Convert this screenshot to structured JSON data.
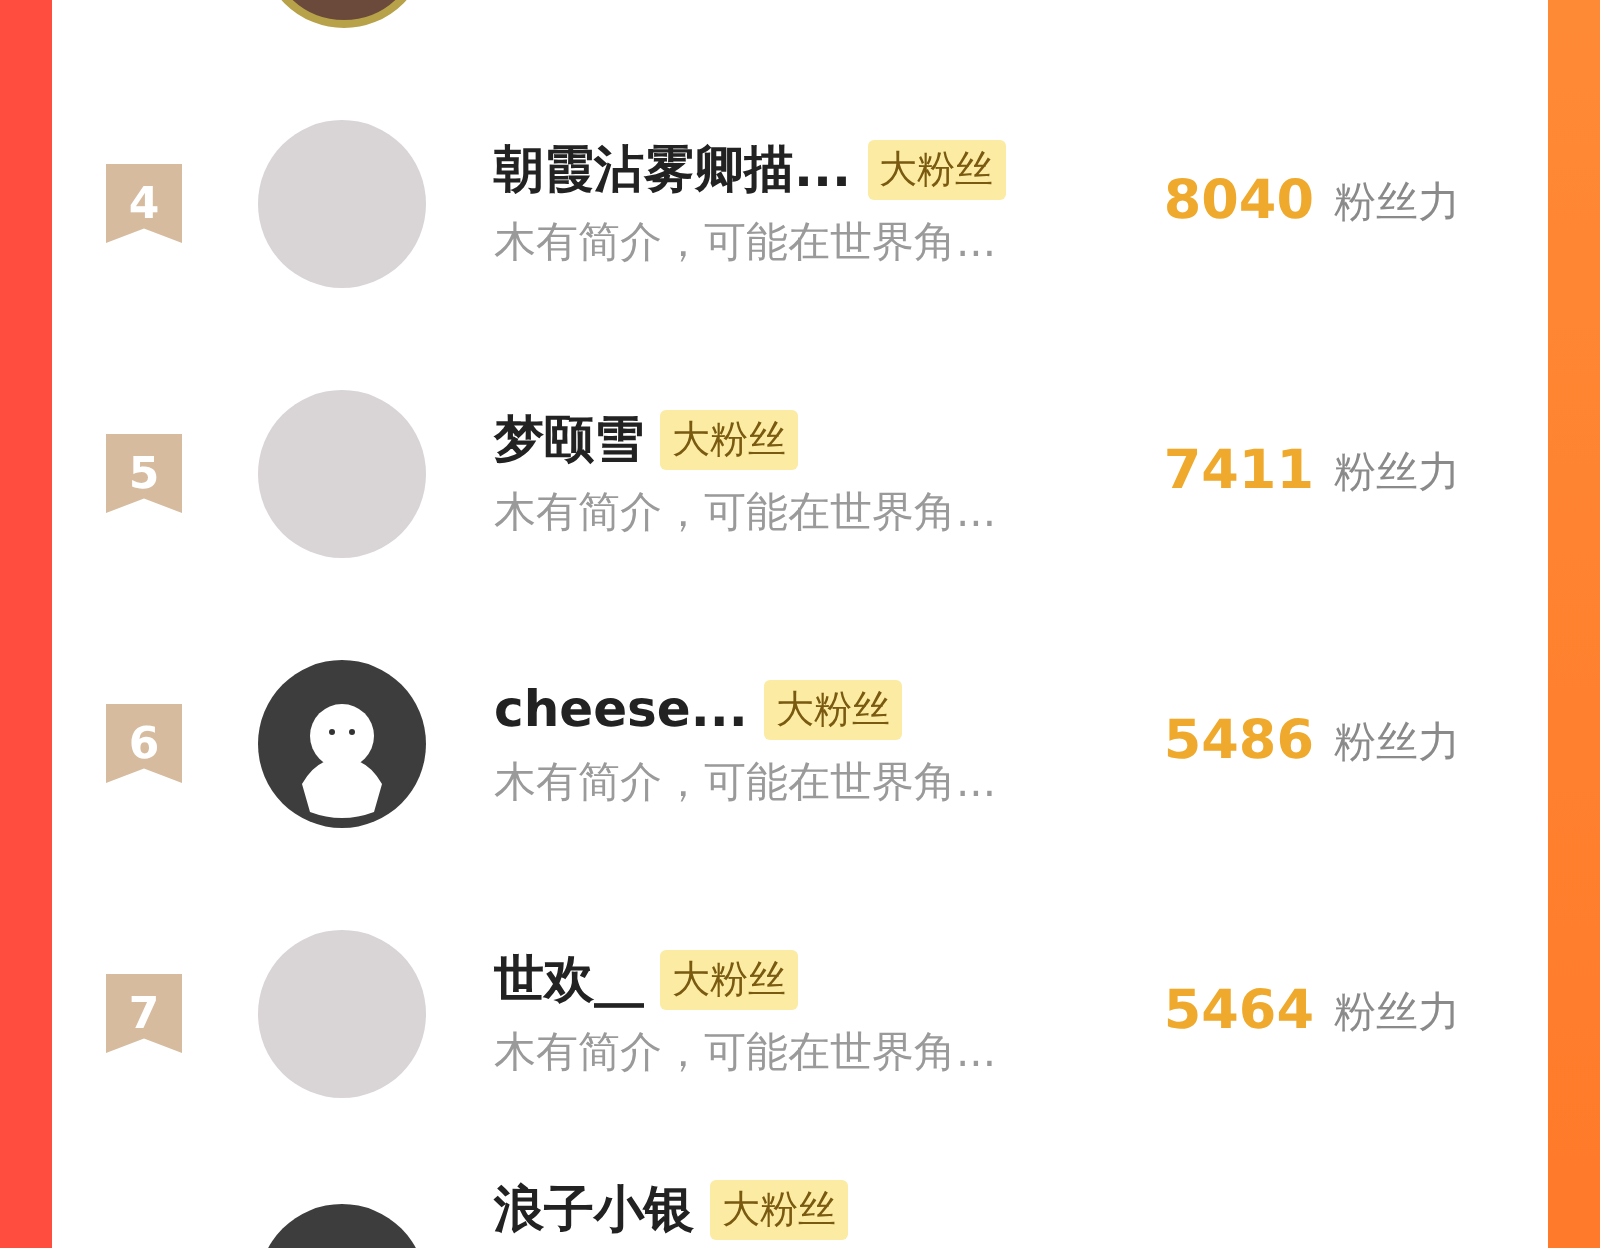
{
  "top_avatar": {
    "kind": "photo"
  },
  "rows": [
    {
      "rank": "4",
      "avatar": {
        "kind": "photo"
      },
      "name": "朝霞沾雾卿描...",
      "badge": "大粉丝",
      "bio": "木有简介，可能在世界角...",
      "score": "8040",
      "unit": "粉丝力"
    },
    {
      "rank": "5",
      "avatar": {
        "kind": "photo"
      },
      "name": "梦颐雪",
      "badge": "大粉丝",
      "bio": "木有简介，可能在世界角...",
      "score": "7411",
      "unit": "粉丝力"
    },
    {
      "rank": "6",
      "avatar": {
        "kind": "default"
      },
      "name": "cheese...",
      "badge": "大粉丝",
      "bio": "木有简介，可能在世界角...",
      "score": "5486",
      "unit": "粉丝力"
    },
    {
      "rank": "7",
      "avatar": {
        "kind": "photo"
      },
      "name": "世欢__",
      "badge": "大粉丝",
      "bio": "木有简介，可能在世界角...",
      "score": "5464",
      "unit": "粉丝力"
    }
  ],
  "partial_row": {
    "avatar": {
      "kind": "default"
    },
    "name": "浪子小银",
    "badge": "大粉丝"
  }
}
